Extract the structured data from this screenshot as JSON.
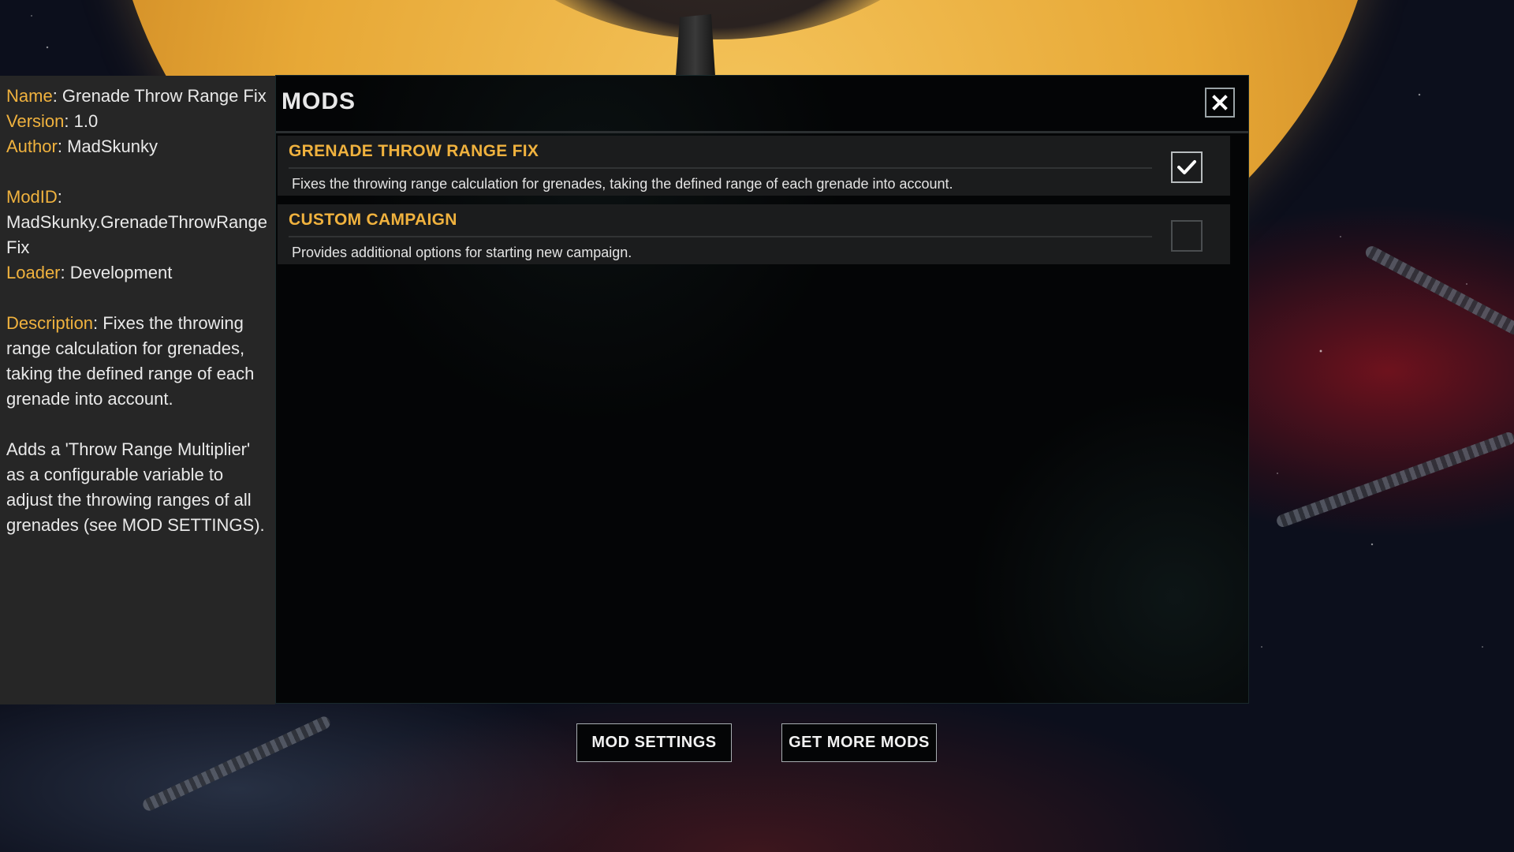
{
  "info_panel": {
    "name_key": "Name",
    "name_value": "Grenade Throw Range Fix",
    "version_key": "Version",
    "version_value": "1.0",
    "author_key": "Author",
    "author_value": "MadSkunky",
    "modid_key": "ModID",
    "modid_value": "MadSkunky.GrenadeThrowRangeFix",
    "loader_key": "Loader",
    "loader_value": "Development",
    "description_key": "Description",
    "description_value": "Fixes the throwing range calculation for grenades, taking the defined range of each grenade into account.",
    "extra_text": "Adds a 'Throw Range Multiplier' as a configurable variable to adjust the throwing ranges of all grenades (see MOD SETTINGS)."
  },
  "mods_window": {
    "title": "MODS",
    "close_icon": "close-x-icon",
    "mods": [
      {
        "name": "GRENADE THROW RANGE FIX",
        "description": "Fixes the throwing range calculation for grenades, taking the defined range of each grenade into account.",
        "enabled": true
      },
      {
        "name": "CUSTOM CAMPAIGN",
        "description": "Provides additional options for starting new campaign.",
        "enabled": false
      }
    ]
  },
  "buttons": {
    "mod_settings": "MOD SETTINGS",
    "get_more_mods": "GET MORE MODS"
  },
  "colors": {
    "accent": "#f0b23e",
    "panel_bg": "#262626",
    "window_bg": "#040506"
  }
}
